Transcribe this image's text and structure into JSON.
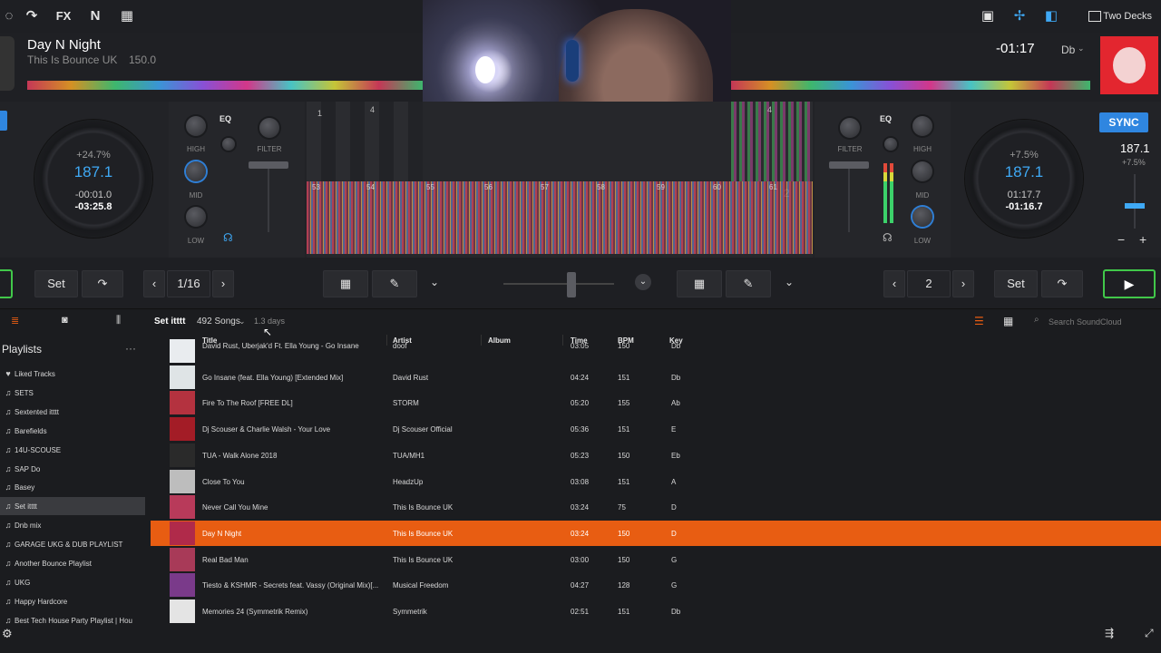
{
  "topbar": {
    "fx_label": "FX",
    "layout_label": "Two Decks"
  },
  "deckA": {
    "title": "Day N Night",
    "artist": "This Is Bounce UK",
    "bpm_small": "150.0",
    "pitch": "+24.7%",
    "bpm": "187.1",
    "time_elapsed": "-00:01.0",
    "time_remain": "-03:25.8",
    "loop_size": "1/16",
    "set_label": "Set"
  },
  "deckB": {
    "remaining": "-01:17",
    "key": "Db",
    "sync_label": "SYNC",
    "bpm_top": "187.1",
    "pitch_small": "+7.5%",
    "pitch": "+7.5%",
    "bpm": "187.1",
    "time_elapsed": "01:17.7",
    "time_remain": "-01:16.7",
    "loop_size": "2",
    "set_label": "Set"
  },
  "mixer": {
    "eq_label": "EQ",
    "high": "HIGH",
    "mid": "MID",
    "low": "LOW",
    "filter": "FILTER",
    "beat_markers": [
      "53",
      "54",
      "55",
      "56",
      "57",
      "58",
      "59",
      "60",
      "61"
    ],
    "deck_markers": [
      "1",
      "4",
      "4",
      "2"
    ]
  },
  "library": {
    "playlist_name": "Set itttt",
    "song_count": "492 Songs",
    "age": "1.3 days",
    "search_placeholder": "Search SoundCloud",
    "columns": [
      "Title",
      "Artist",
      "Album",
      "Time",
      "BPM",
      "Key"
    ]
  },
  "sidebar": {
    "title": "Playlists",
    "more": "···",
    "items": [
      {
        "label": "Liked Tracks",
        "icon": "♥"
      },
      {
        "label": "SETS",
        "icon": "♫"
      },
      {
        "label": "Sextented itttt",
        "icon": "♫"
      },
      {
        "label": "Barefields",
        "icon": "♫"
      },
      {
        "label": "14U-SCOUSE",
        "icon": "♫"
      },
      {
        "label": "SAP Do",
        "icon": "♫"
      },
      {
        "label": "Basey",
        "icon": "♫"
      },
      {
        "label": "Set itttt",
        "icon": "♫"
      },
      {
        "label": "Dnb mix",
        "icon": "♫"
      },
      {
        "label": "GARAGE UKG & DUB PLAYLIST",
        "icon": "♫"
      },
      {
        "label": "Another Bounce Playlist",
        "icon": "♫"
      },
      {
        "label": "UKG",
        "icon": "♫"
      },
      {
        "label": "Happy Hardcore",
        "icon": "♫"
      },
      {
        "label": "Best Tech House Party Playlist | Hou",
        "icon": "♫"
      }
    ]
  },
  "tracks": [
    {
      "title": "David Rust, Uberjak'd Ft. Ella Young - Go Insane",
      "artist": "doof",
      "album": "",
      "time": "03:05",
      "bpm": "150",
      "key": "Db",
      "thumb": "#e9ecef"
    },
    {
      "title": "Go Insane (feat. Ella Young) [Extended Mix]",
      "artist": "David Rust",
      "album": "",
      "time": "04:24",
      "bpm": "151",
      "key": "Db",
      "thumb": "#dfe4e6"
    },
    {
      "title": "Fire To The Roof [FREE DL]",
      "artist": "STORM",
      "album": "",
      "time": "05:20",
      "bpm": "155",
      "key": "Ab",
      "thumb": "#b4323f"
    },
    {
      "title": "Dj Scouser & Charlie Walsh - Your Love",
      "artist": "Dj Scouser Official",
      "album": "",
      "time": "05:36",
      "bpm": "151",
      "key": "E",
      "thumb": "#a31c26"
    },
    {
      "title": "TUA - Walk Alone 2018",
      "artist": "TUA/MH1",
      "album": "",
      "time": "05:23",
      "bpm": "150",
      "key": "Eb",
      "thumb": "#2a2a2a"
    },
    {
      "title": "Close To You",
      "artist": "HeadzUp",
      "album": "",
      "time": "03:08",
      "bpm": "151",
      "key": "A",
      "thumb": "#bdbdbd"
    },
    {
      "title": "Never Call You Mine",
      "artist": "This Is Bounce UK",
      "album": "",
      "time": "03:24",
      "bpm": "75",
      "key": "D",
      "thumb": "#b83a5a"
    },
    {
      "title": "Day N Night",
      "artist": "This Is Bounce UK",
      "album": "",
      "time": "03:24",
      "bpm": "150",
      "key": "D",
      "thumb": "#b02a4a",
      "selected": true
    },
    {
      "title": "Real Bad Man",
      "artist": "This Is Bounce UK",
      "album": "",
      "time": "03:00",
      "bpm": "150",
      "key": "G",
      "thumb": "#a83a58"
    },
    {
      "title": "Tiesto & KSHMR - Secrets feat. Vassy (Original Mix)[...",
      "artist": "Musical Freedom",
      "album": "",
      "time": "04:27",
      "bpm": "128",
      "key": "G",
      "thumb": "#7a3a8a"
    },
    {
      "title": "Memories 24 (Symmetrik Remix)",
      "artist": "Symmetrik",
      "album": "",
      "time": "02:51",
      "bpm": "151",
      "key": "Db",
      "thumb": "#e4e4e4"
    }
  ],
  "colors": {
    "accent": "#e85d12",
    "bpm_blue": "#3fa9f5",
    "sync_blue": "#2f86e0",
    "play_green": "#41c84a"
  }
}
